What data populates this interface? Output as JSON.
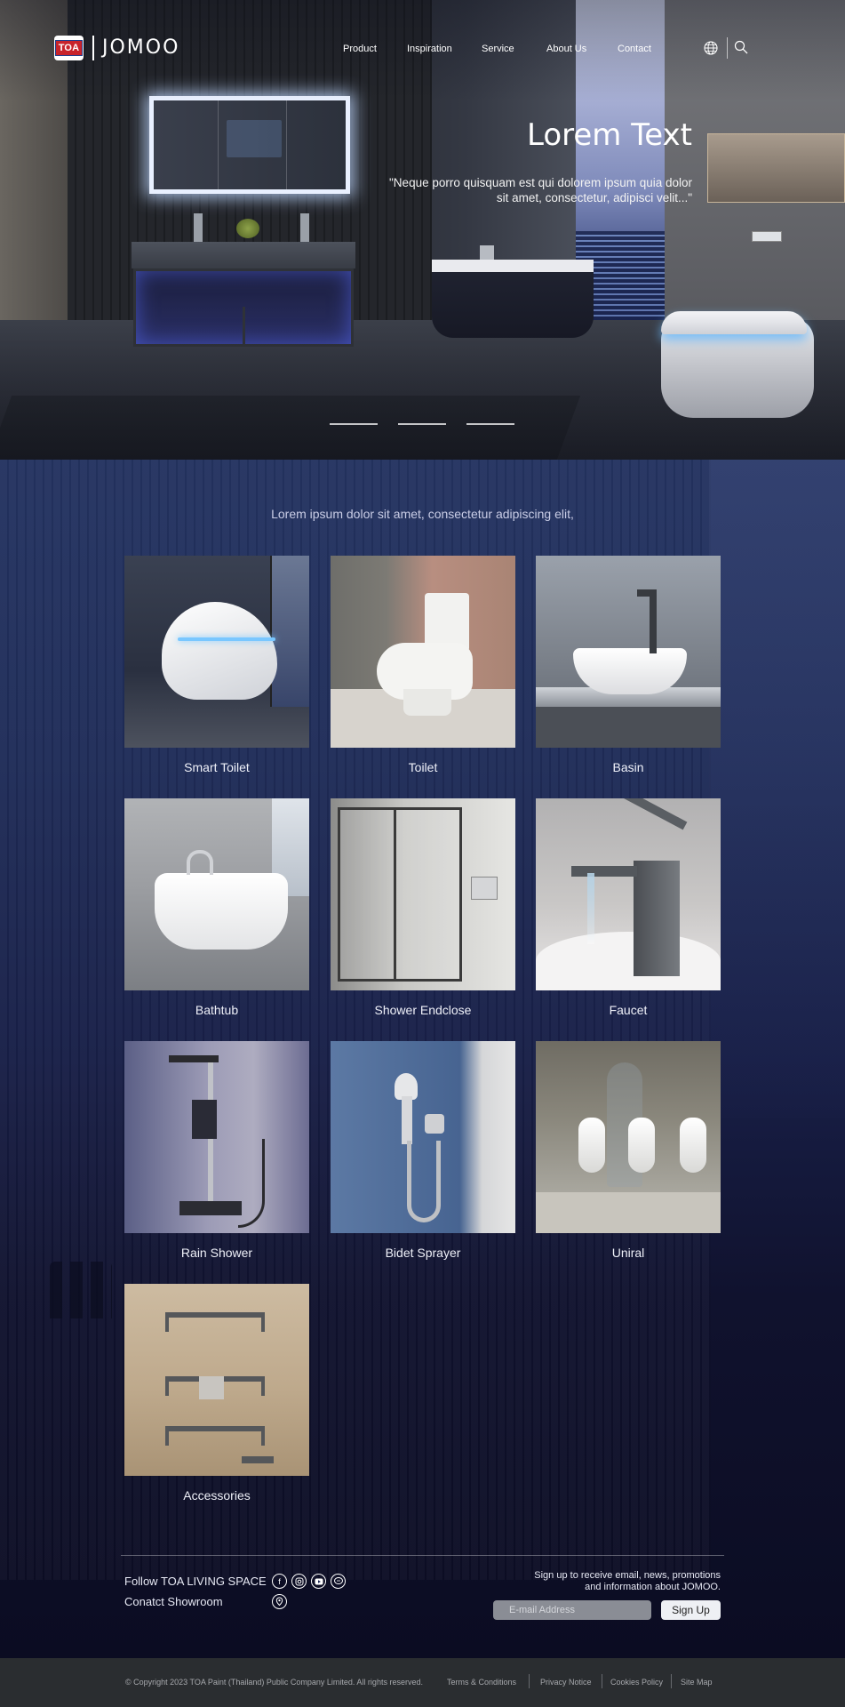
{
  "brand": {
    "badge": "TOA",
    "name": "JOMOO"
  },
  "nav": {
    "items": [
      "Product",
      "Inspiration",
      "Service",
      "About Us",
      "Contact"
    ],
    "icons": [
      "globe-icon",
      "search-icon"
    ]
  },
  "hero": {
    "title": "Lorem Text",
    "quote": "\"Neque porro quisquam est qui dolorem ipsum quia dolor sit amet, consectetur, adipisci velit...\"",
    "slides_count": 3
  },
  "products": {
    "intro": "Lorem ipsum dolor sit amet, consectetur adipiscing elit,",
    "items": [
      {
        "label": "Smart Toilet"
      },
      {
        "label": "Toilet"
      },
      {
        "label": "Basin"
      },
      {
        "label": "Bathtub"
      },
      {
        "label": "Shower Endclose"
      },
      {
        "label": "Faucet"
      },
      {
        "label": "Rain Shower"
      },
      {
        "label": "Bidet Sprayer"
      },
      {
        "label": "Uniral"
      },
      {
        "label": "Accessories"
      }
    ]
  },
  "footer": {
    "follow_label": "Follow TOA LIVING SPACE",
    "showroom_label": "Conatct Showroom",
    "social_icons": [
      "facebook-icon",
      "instagram-icon",
      "youtube-icon",
      "line-icon"
    ],
    "signup_text_1": "Sign up to receive email, news, promotions",
    "signup_text_2": "and information about JOMOO.",
    "email_placeholder": "E-mail Address",
    "signup_button": "Sign Up",
    "copyright": "© Copyright 2023 TOA Paint (Thailand) Public Company Limited. All rights reserved.",
    "links": [
      "Terms & Conditions",
      "Privacy Notice",
      "Cookies Policy",
      "Site Map"
    ]
  },
  "colors": {
    "main_bg_top": "#243361",
    "main_bg_bottom": "#0b0c22",
    "bottom_bar": "#2a2d30",
    "brand_red": "#c8232b"
  }
}
